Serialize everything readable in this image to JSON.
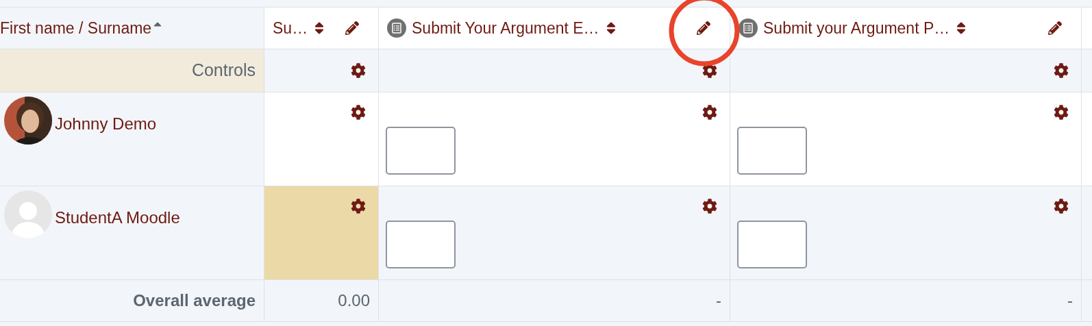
{
  "header": {
    "name_column": {
      "label": "First name / Surname",
      "sorted_ascending": true
    },
    "columns": [
      {
        "label": "Su…",
        "kind": "total",
        "sortable": true
      },
      {
        "label": "Submit Your Argument E…",
        "kind": "activity",
        "sortable": true
      },
      {
        "label": "Submit your Argument P…",
        "kind": "activity",
        "sortable": true
      }
    ]
  },
  "controls_row": {
    "label": "Controls"
  },
  "students": [
    {
      "name": "Johnny Demo",
      "has_photo": true,
      "cells": [
        {
          "kind": "plain",
          "highlighted": false
        },
        {
          "kind": "input",
          "highlighted": false
        },
        {
          "kind": "input",
          "highlighted": false
        }
      ]
    },
    {
      "name": "StudentA Moodle",
      "has_photo": false,
      "cells": [
        {
          "kind": "plain",
          "highlighted": true
        },
        {
          "kind": "input",
          "highlighted": false
        },
        {
          "kind": "input",
          "highlighted": false
        }
      ]
    }
  ],
  "average": {
    "label": "Overall average",
    "values": [
      "0.00",
      "-",
      "-"
    ]
  }
}
